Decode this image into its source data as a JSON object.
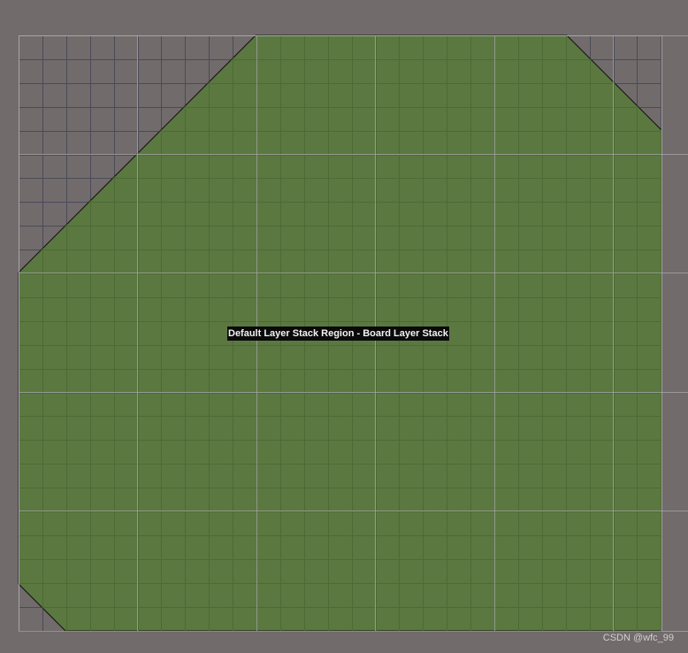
{
  "canvas": {
    "background_color": "#716b6b",
    "grid_fine_color": "#4a4a58",
    "grid_coarse_color": "#a8a8a8",
    "board_fill_color": "#5b7841",
    "board_outline_color": "#101010"
  },
  "board": {
    "region_label": "Default Layer Stack Region - Board Layer Stack"
  },
  "watermark": {
    "text": "CSDN @wfc_99"
  }
}
